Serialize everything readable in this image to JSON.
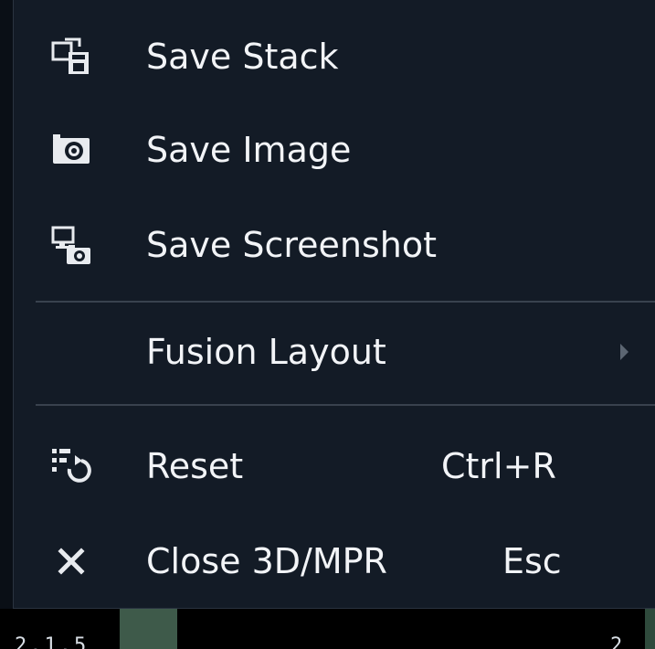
{
  "context_menu": {
    "items": [
      {
        "label": "Save Stack",
        "icon": "save-stack-icon",
        "shortcut": ""
      },
      {
        "label": "Save Image",
        "icon": "camera-icon",
        "shortcut": ""
      },
      {
        "label": "Save Screenshot",
        "icon": "screenshot-icon",
        "shortcut": ""
      },
      {
        "label": "Fusion Layout",
        "icon": "",
        "shortcut": "",
        "has_submenu": true
      },
      {
        "label": "Reset",
        "icon": "reset-icon",
        "shortcut": "Ctrl+R"
      },
      {
        "label": "Close 3D/MPR",
        "icon": "close-icon",
        "shortcut": "Esc"
      }
    ]
  },
  "colors": {
    "menu_background": "#131b26",
    "menu_text": "#f2f4f7",
    "divider": "#39424e",
    "icon": "#e8ebef"
  },
  "background_strip": {
    "left_text": "2.1.5",
    "right_text": "2"
  }
}
